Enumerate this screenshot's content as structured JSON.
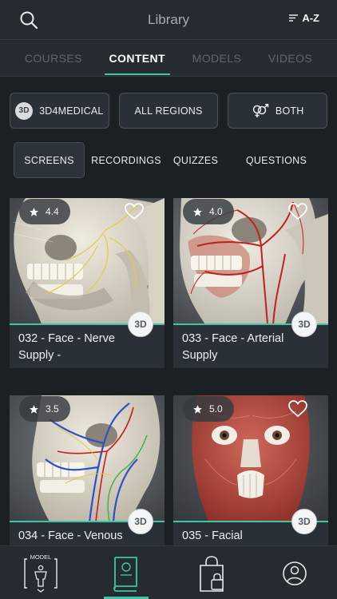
{
  "header": {
    "title": "Library",
    "sort_label": "A-Z"
  },
  "tabs": [
    {
      "label": "COURSES",
      "active": false
    },
    {
      "label": "CONTENT",
      "active": true
    },
    {
      "label": "MODELS",
      "active": false
    },
    {
      "label": "VIDEOS",
      "active": false
    }
  ],
  "filters": {
    "publisher": {
      "logo_text": "3D",
      "label": "3D4MEDICAL"
    },
    "region": {
      "label": "ALL REGIONS"
    },
    "gender": {
      "label": "BOTH"
    }
  },
  "segments": [
    {
      "label": "SCREENS",
      "active": true
    },
    {
      "label": "RECORDINGS",
      "active": false
    },
    {
      "label": "QUIZZES",
      "active": false
    },
    {
      "label": "QUESTIONS",
      "active": false
    }
  ],
  "cards": [
    {
      "rating": "4.4",
      "title": "032 - Face - Nerve Supply -",
      "badge": "3D"
    },
    {
      "rating": "4.0",
      "title": "033 - Face - Arterial Supply",
      "badge": "3D"
    },
    {
      "rating": "3.5",
      "title": "034 - Face - Venous",
      "badge": "3D"
    },
    {
      "rating": "5.0",
      "title": "035 - Facial",
      "badge": "3D"
    }
  ],
  "bottom_nav": {
    "model_label": "MODEL"
  },
  "colors": {
    "accent": "#3ec5a6",
    "background": "#1b2025",
    "bar": "#262b31"
  }
}
